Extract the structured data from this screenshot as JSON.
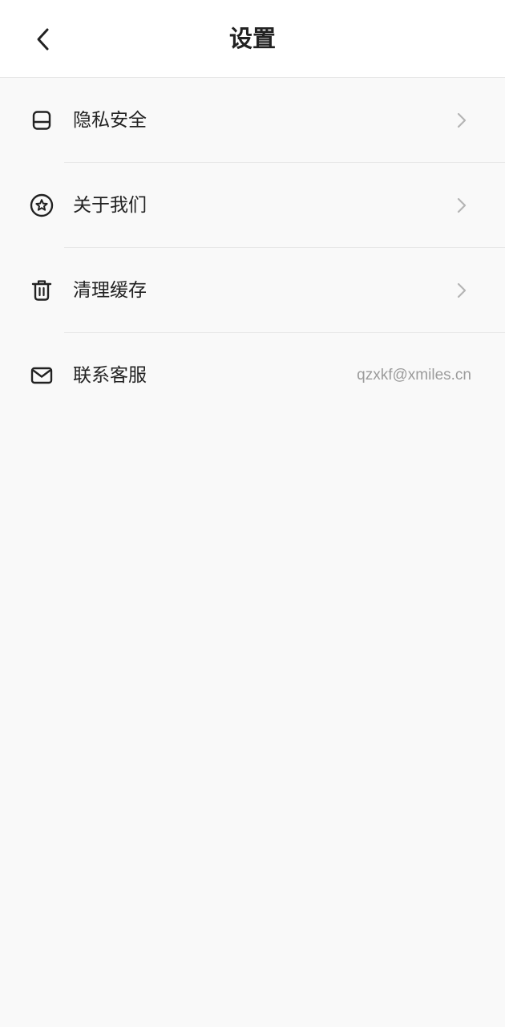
{
  "header": {
    "title": "设置"
  },
  "settings": {
    "items": [
      {
        "label": "隐私安全",
        "icon": "privacy-icon"
      },
      {
        "label": "关于我们",
        "icon": "star-badge-icon"
      },
      {
        "label": "清理缓存",
        "icon": "trash-icon"
      },
      {
        "label": "联系客服",
        "icon": "mail-icon",
        "value": "qzxkf@xmiles.cn"
      }
    ]
  },
  "colors": {
    "background": "#f9f9f9",
    "header_background": "#ffffff",
    "text": "#222222",
    "secondary_text": "#9b9b9b",
    "chevron": "#b5b5b5",
    "divider": "#e8e8e8"
  }
}
